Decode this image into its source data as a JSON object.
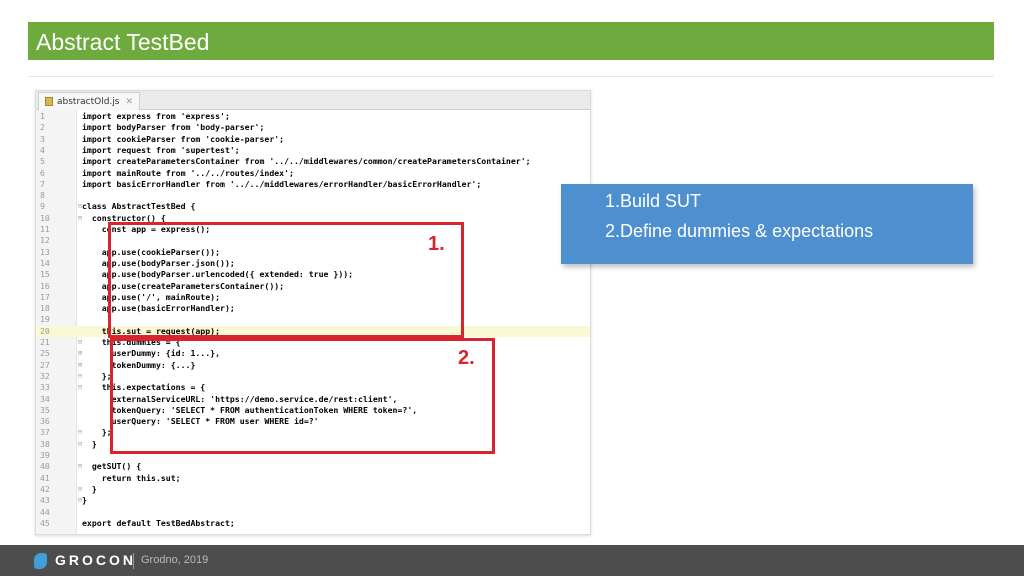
{
  "slide": {
    "title": "Abstract TestBed",
    "title_bar_color": "#6faa3f"
  },
  "editor": {
    "tab_label": "abstractOld.js",
    "tab_icon": "js-file-icon",
    "highlighted_line": "20",
    "lines": [
      {
        "num": "1",
        "fold": "",
        "text": "import express from 'express';"
      },
      {
        "num": "2",
        "fold": "",
        "text": "import bodyParser from 'body-parser';"
      },
      {
        "num": "3",
        "fold": "",
        "text": "import cookieParser from 'cookie-parser';"
      },
      {
        "num": "4",
        "fold": "",
        "text": "import request from 'supertest';"
      },
      {
        "num": "5",
        "fold": "",
        "text": "import createParametersContainer from '../../middlewares/common/createParametersContainer';"
      },
      {
        "num": "6",
        "fold": "",
        "text": "import mainRoute from '../../routes/index';"
      },
      {
        "num": "7",
        "fold": "",
        "text": "import basicErrorHandler from '../../middlewares/errorHandler/basicErrorHandler';"
      },
      {
        "num": "8",
        "fold": "",
        "text": ""
      },
      {
        "num": "9",
        "fold": "⊟",
        "text": "class AbstractTestBed {"
      },
      {
        "num": "10",
        "fold": "⊟",
        "text": "  constructor() {"
      },
      {
        "num": "11",
        "fold": "",
        "text": "    const app = express();"
      },
      {
        "num": "12",
        "fold": "",
        "text": ""
      },
      {
        "num": "13",
        "fold": "",
        "text": "    app.use(cookieParser());"
      },
      {
        "num": "14",
        "fold": "",
        "text": "    app.use(bodyParser.json());"
      },
      {
        "num": "15",
        "fold": "",
        "text": "    app.use(bodyParser.urlencoded({ extended: true }));"
      },
      {
        "num": "16",
        "fold": "",
        "text": "    app.use(createParametersContainer());"
      },
      {
        "num": "17",
        "fold": "",
        "text": "    app.use('/', mainRoute);"
      },
      {
        "num": "18",
        "fold": "",
        "text": "    app.use(basicErrorHandler);"
      },
      {
        "num": "19",
        "fold": "",
        "text": ""
      },
      {
        "num": "20",
        "fold": "",
        "text": "    this.sut = request(app);"
      },
      {
        "num": "21",
        "fold": "⊟",
        "text": "    this.dummies = {"
      },
      {
        "num": "25",
        "fold": "⊞",
        "text": "      userDummy: {id: 1...},"
      },
      {
        "num": "27",
        "fold": "⊞",
        "text": "      tokenDummy: {...}"
      },
      {
        "num": "32",
        "fold": "⊟",
        "text": "    };"
      },
      {
        "num": "33",
        "fold": "⊟",
        "text": "    this.expectations = {"
      },
      {
        "num": "34",
        "fold": "",
        "text": "      externalServiceURL: 'https://demo.service.de/rest:client',"
      },
      {
        "num": "35",
        "fold": "",
        "text": "      tokenQuery: 'SELECT * FROM authenticationToken WHERE token=?',"
      },
      {
        "num": "36",
        "fold": "",
        "text": "      userQuery: 'SELECT * FROM user WHERE id=?'"
      },
      {
        "num": "37",
        "fold": "⊟",
        "text": "    };"
      },
      {
        "num": "38",
        "fold": "⊟",
        "text": "  }"
      },
      {
        "num": "39",
        "fold": "",
        "text": ""
      },
      {
        "num": "40",
        "fold": "⊟",
        "text": "  getSUT() {"
      },
      {
        "num": "41",
        "fold": "",
        "text": "    return this.sut;"
      },
      {
        "num": "42",
        "fold": "⊟",
        "text": "  }"
      },
      {
        "num": "43",
        "fold": "⊟",
        "text": "}"
      },
      {
        "num": "44",
        "fold": "",
        "text": ""
      },
      {
        "num": "45",
        "fold": "",
        "text": "export default TestBedAbstract;"
      }
    ]
  },
  "annotations": {
    "box1_label": "1.",
    "box2_label": "2.",
    "color": "#d9232e"
  },
  "callout": {
    "items": [
      "1.Build SUT",
      "2.Define dummies & expectations"
    ],
    "color": "#4e8fd0"
  },
  "footer": {
    "brand": "GROCON",
    "subtitle": "Grodno, 2019",
    "logo_icon": "grocon-logo-icon"
  }
}
